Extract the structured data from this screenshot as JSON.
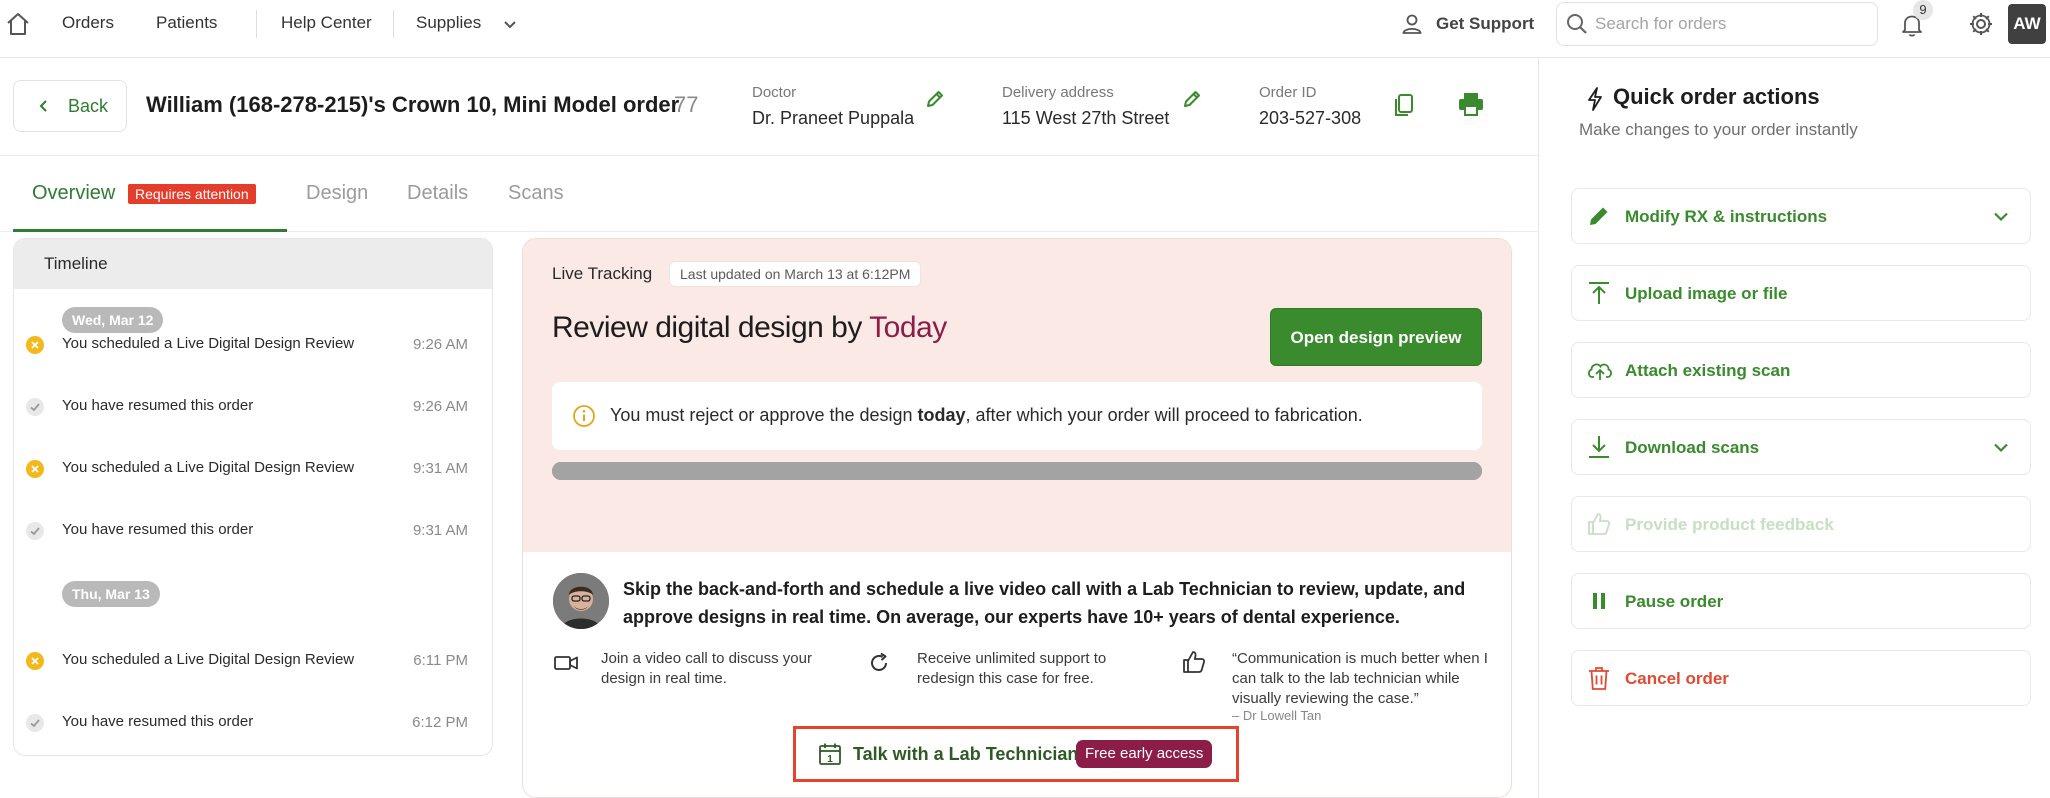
{
  "nav": {
    "orders": "Orders",
    "patients": "Patients",
    "help_center": "Help Center",
    "supplies": "Supplies",
    "get_support": "Get Support",
    "search_placeholder": "Search for orders",
    "notification_count": "9",
    "avatar_initials": "AW"
  },
  "header": {
    "back_label": "Back",
    "order_title": "William (168-278-215)'s Crown 10, Mini Model order",
    "order_count": "77",
    "doctor_label": "Doctor",
    "doctor_value": "Dr. Praneet Puppala",
    "delivery_label": "Delivery address",
    "delivery_value": "115 West 27th Street",
    "order_id_label": "Order ID",
    "order_id_value": "203-527-308"
  },
  "tabs": {
    "overview": "Overview",
    "attention_badge": "Requires attention",
    "design": "Design",
    "details": "Details",
    "scans": "Scans"
  },
  "timeline": {
    "title": "Timeline",
    "groups": [
      {
        "date": "Wed, Mar 12",
        "events": [
          {
            "text": "You scheduled a Live Digital Design Review",
            "time": "9:26 AM",
            "status": "scheduled"
          },
          {
            "text": "You have resumed this order",
            "time": "9:26 AM",
            "status": "done"
          },
          {
            "text": "You scheduled a Live Digital Design Review",
            "time": "9:31 AM",
            "status": "scheduled"
          },
          {
            "text": "You have resumed this order",
            "time": "9:31 AM",
            "status": "done"
          }
        ]
      },
      {
        "date": "Thu, Mar 13",
        "events": [
          {
            "text": "You scheduled a Live Digital Design Review",
            "time": "6:11 PM",
            "status": "scheduled"
          },
          {
            "text": "You have resumed this order",
            "time": "6:12 PM",
            "status": "done"
          }
        ]
      }
    ]
  },
  "tracking": {
    "label": "Live Tracking",
    "updated": "Last updated on March 13 at 6:12PM",
    "heading_prefix": "Review digital design by ",
    "heading_highlight": "Today",
    "open_button": "Open design preview",
    "notice_before": "You must reject or approve the design ",
    "notice_bold": "today",
    "notice_after": ", after which your order will proceed to fabrication.",
    "progress": 1.0
  },
  "promo": {
    "text": "Skip the back-and-forth and schedule a live video call with a Lab Technician to review, update, and approve designs in real time. On average, our experts have 10+ years of dental experience.",
    "feature_1": "Join a video call to discuss your design in real time.",
    "feature_2": "Receive unlimited support to redesign this case for free.",
    "quote": "“Communication is much better when I can talk to the lab technician while visually reviewing the case.”",
    "quote_author": "– Dr Lowell Tan",
    "talk_label": "Talk with a Lab Technician",
    "free_badge": "Free early access",
    "calendar_day": "1"
  },
  "quick_actions": {
    "title": "Quick order actions",
    "subtitle": "Make changes to your order instantly",
    "items": [
      {
        "label": "Modify RX & instructions"
      },
      {
        "label": "Upload image or file"
      },
      {
        "label": "Attach existing scan"
      },
      {
        "label": "Download scans"
      },
      {
        "label": "Provide product feedback"
      },
      {
        "label": "Pause order"
      },
      {
        "label": "Cancel order"
      }
    ]
  },
  "colors": {
    "accent_green": "#3a8a2e",
    "brand_maroon": "#8c1d48",
    "danger_red": "#e04a32",
    "attention_red": "#e43d2b",
    "tracking_bg": "#fbe9e6"
  }
}
